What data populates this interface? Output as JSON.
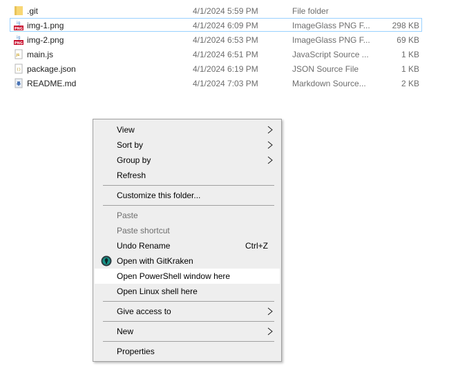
{
  "files": [
    {
      "name": ".git",
      "date": "4/1/2024 5:59 PM",
      "type": "File folder",
      "size": "",
      "icon": "folder-icon",
      "focused": false
    },
    {
      "name": "img-1.png",
      "date": "4/1/2024 6:09 PM",
      "type": "ImageGlass PNG F...",
      "size": "298 KB",
      "icon": "png-image-icon",
      "focused": true
    },
    {
      "name": "img-2.png",
      "date": "4/1/2024 6:53 PM",
      "type": "ImageGlass PNG F...",
      "size": "69 KB",
      "icon": "png-image-icon",
      "focused": false
    },
    {
      "name": "main.js",
      "date": "4/1/2024 6:51 PM",
      "type": "JavaScript Source ...",
      "size": "1 KB",
      "icon": "js-file-icon",
      "focused": false
    },
    {
      "name": "package.json",
      "date": "4/1/2024 6:19 PM",
      "type": "JSON Source File",
      "size": "1 KB",
      "icon": "json-file-icon",
      "focused": false
    },
    {
      "name": "README.md",
      "date": "4/1/2024 7:03 PM",
      "type": "Markdown Source...",
      "size": "2 KB",
      "icon": "markdown-file-icon",
      "focused": false
    }
  ],
  "context_menu": {
    "view": "View",
    "sort_by": "Sort by",
    "group_by": "Group by",
    "refresh": "Refresh",
    "customize": "Customize this folder...",
    "paste": "Paste",
    "paste_shortcut": "Paste shortcut",
    "undo_rename": "Undo Rename",
    "undo_shortcut": "Ctrl+Z",
    "open_gitkraken": "Open with GitKraken",
    "open_powershell": "Open PowerShell window here",
    "open_linux_shell": "Open Linux shell here",
    "give_access": "Give access to",
    "new": "New",
    "properties": "Properties"
  },
  "colors": {
    "focus_border": "#99d1ff",
    "menu_background": "#eeeeee",
    "menu_hover": "#ffffff",
    "disabled_text": "#6d6d6d",
    "png_badge": "#c8102e",
    "gitkraken": "#179287"
  }
}
